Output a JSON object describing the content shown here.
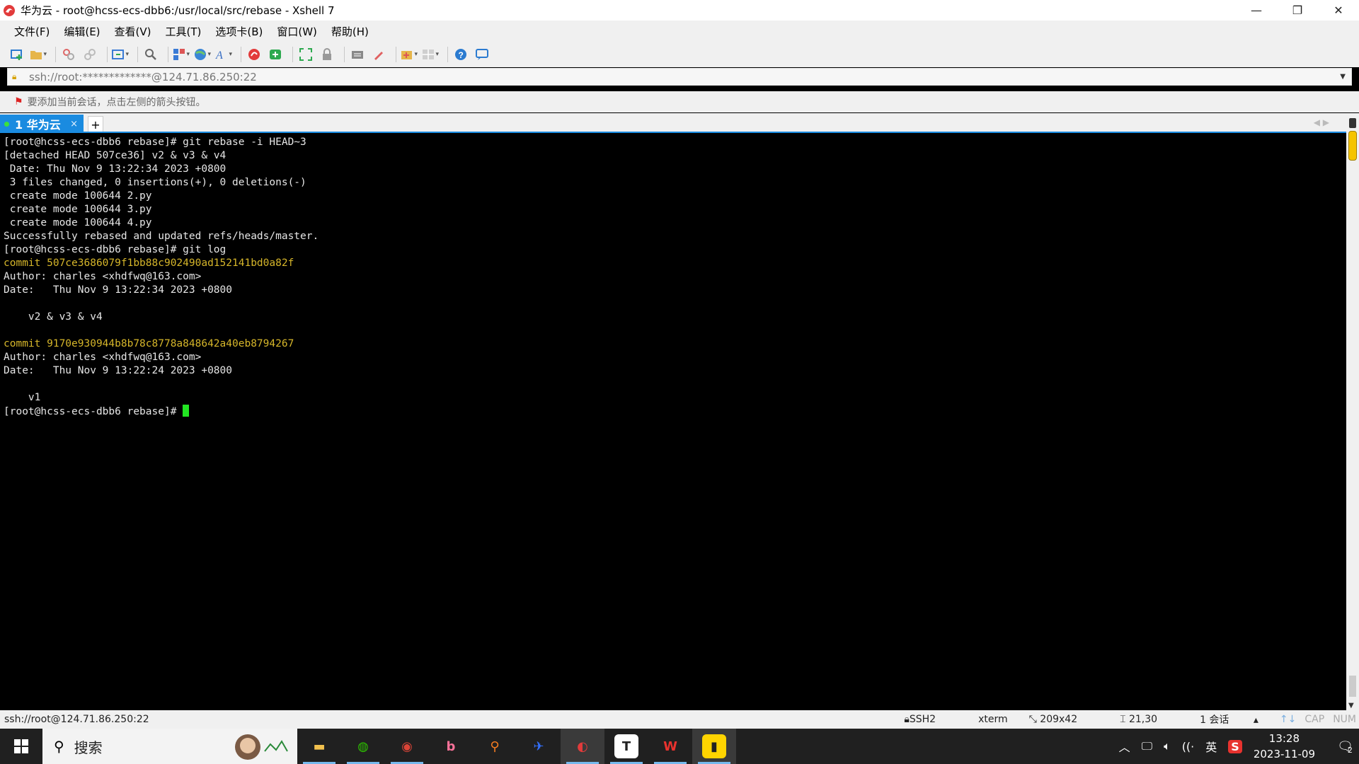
{
  "window": {
    "title": "华为云 - root@hcss-ecs-dbb6:/usr/local/src/rebase - Xshell 7",
    "minimize": "—",
    "restore": "❐",
    "close": "✕"
  },
  "menu": {
    "items": [
      "文件(F)",
      "编辑(E)",
      "查看(V)",
      "工具(T)",
      "选项卡(B)",
      "窗口(W)",
      "帮助(H)"
    ]
  },
  "address": {
    "url": "ssh://root:*************@124.71.86.250:22"
  },
  "hint": {
    "text": "要添加当前会话，点击左侧的箭头按钮。"
  },
  "tabs": {
    "active_label": "1 华为云",
    "close": "×",
    "add": "+"
  },
  "terminal": {
    "lines": [
      {
        "text": "[root@hcss-ecs-dbb6 rebase]# git rebase -i HEAD~3",
        "color": "white"
      },
      {
        "text": "[detached HEAD 507ce36] v2 & v3 & v4",
        "color": "white"
      },
      {
        "text": " Date: Thu Nov 9 13:22:34 2023 +0800",
        "color": "white"
      },
      {
        "text": " 3 files changed, 0 insertions(+), 0 deletions(-)",
        "color": "white"
      },
      {
        "text": " create mode 100644 2.py",
        "color": "white"
      },
      {
        "text": " create mode 100644 3.py",
        "color": "white"
      },
      {
        "text": " create mode 100644 4.py",
        "color": "white"
      },
      {
        "text": "Successfully rebased and updated refs/heads/master.",
        "color": "white"
      },
      {
        "text": "[root@hcss-ecs-dbb6 rebase]# git log",
        "color": "white"
      },
      {
        "text": "commit 507ce3686079f1bb88c902490ad152141bd0a82f",
        "color": "yellow"
      },
      {
        "text": "Author: charles <xhdfwq@163.com>",
        "color": "white"
      },
      {
        "text": "Date:   Thu Nov 9 13:22:34 2023 +0800",
        "color": "white"
      },
      {
        "text": "",
        "color": "white"
      },
      {
        "text": "    v2 & v3 & v4",
        "color": "white"
      },
      {
        "text": "",
        "color": "white"
      },
      {
        "text": "commit 9170e930944b8b78c8778a848642a40eb8794267",
        "color": "yellow"
      },
      {
        "text": "Author: charles <xhdfwq@163.com>",
        "color": "white"
      },
      {
        "text": "Date:   Thu Nov 9 13:22:24 2023 +0800",
        "color": "white"
      },
      {
        "text": "",
        "color": "white"
      },
      {
        "text": "    v1",
        "color": "white"
      }
    ],
    "prompt": "[root@hcss-ecs-dbb6 rebase]# ",
    "colors": {
      "white": "#e6e6e6",
      "yellow": "#d6b62a",
      "cursor": "#22e622"
    }
  },
  "status": {
    "connection": "ssh://root@124.71.86.250:22",
    "protocol": "SSH2",
    "term": "xterm",
    "size": "209x42",
    "cursor_pos": "21,30",
    "sessions": "1 会话",
    "cap": "CAP",
    "num": "NUM"
  },
  "taskbar": {
    "search_label": "搜索",
    "apps": [
      {
        "name": "file-explorer-icon",
        "glyph": "▬",
        "color": "#f2c14e"
      },
      {
        "name": "wechat-icon",
        "glyph": "◍",
        "color": "#2dc100"
      },
      {
        "name": "chrome-icon",
        "glyph": "◉",
        "color": "#db4437"
      },
      {
        "name": "bilibili-icon",
        "glyph": "b",
        "color": "#fb7299"
      },
      {
        "name": "search-app-icon",
        "glyph": "⚲",
        "color": "#f47b20"
      },
      {
        "name": "feishu-icon",
        "glyph": "✈",
        "color": "#3370ff"
      },
      {
        "name": "xshell-icon",
        "glyph": "◐",
        "color": "#e23b3b"
      },
      {
        "name": "typora-icon",
        "glyph": "T",
        "color": "#ffffff"
      },
      {
        "name": "wps-icon",
        "glyph": "W",
        "color": "#e8322e"
      },
      {
        "name": "chart-app-icon",
        "glyph": "▮",
        "color": "#ffd400"
      }
    ],
    "tray_ime": "英",
    "time": "13:28",
    "date": "2023-11-09",
    "notif_count": "2"
  }
}
